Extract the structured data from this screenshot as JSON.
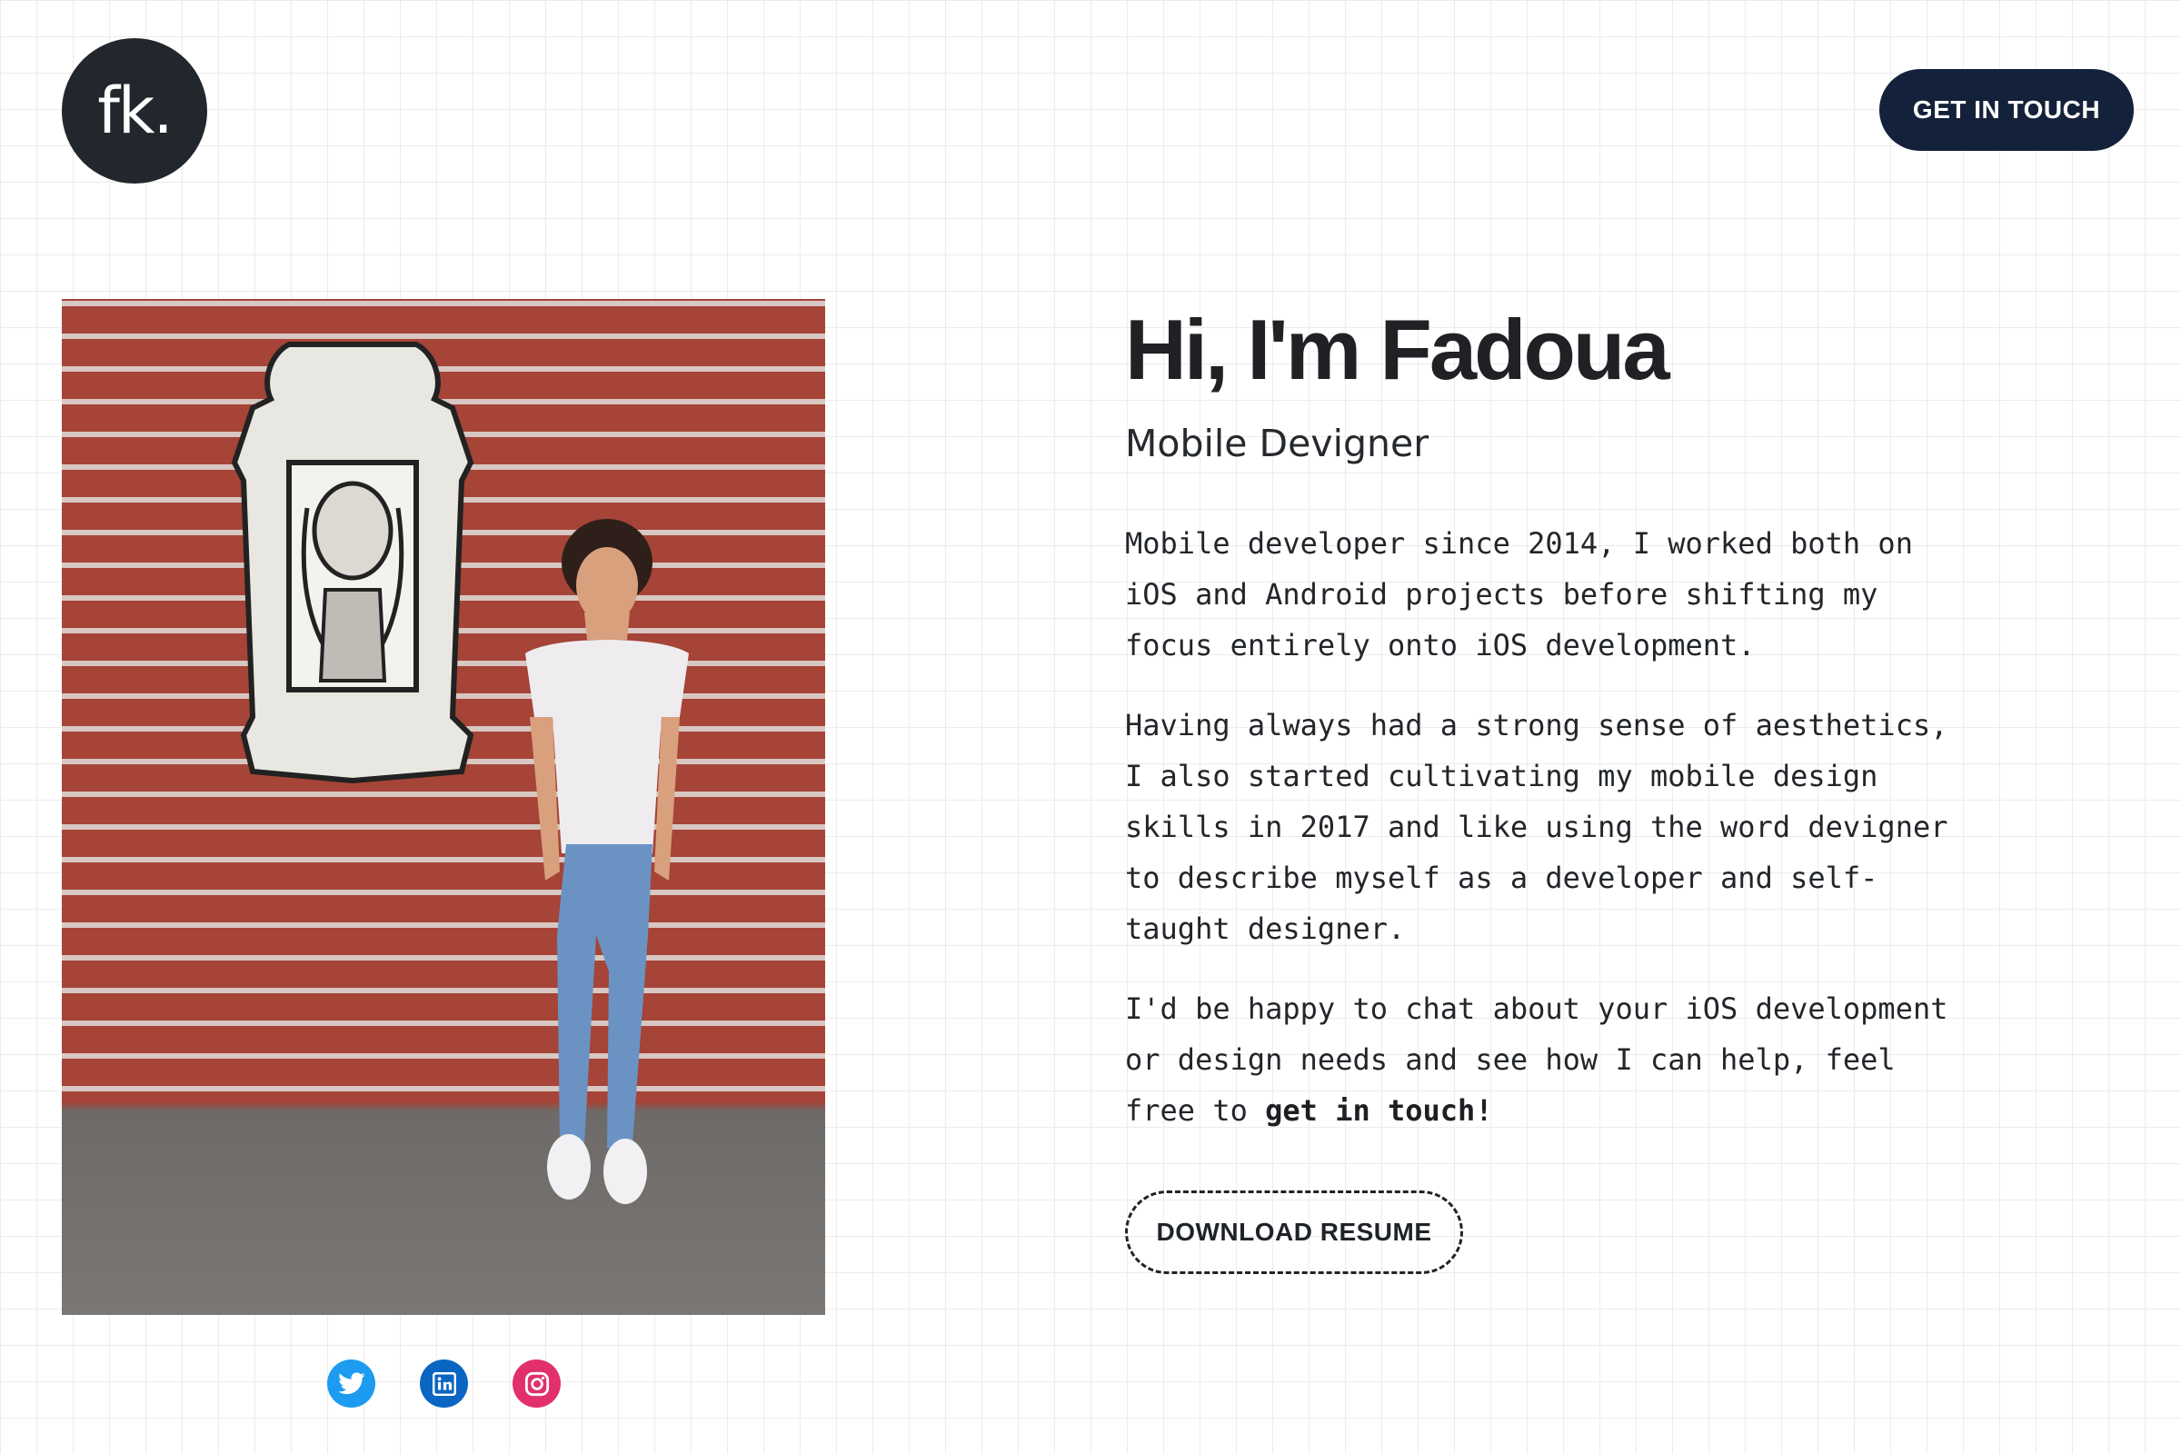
{
  "header": {
    "logo_text": "fk.",
    "cta_label": "GET IN TOUCH",
    "colors": {
      "logo_bg": "#22272d",
      "cta_bg": "#14213a"
    }
  },
  "hero": {
    "title": "Hi, I'm Fadoua",
    "subtitle": "Mobile Devigner",
    "paragraph_1": "Mobile developer since 2014, I worked both on iOS and Android projects before shifting my focus entirely onto iOS development.",
    "paragraph_2": "Having always had a strong sense of aesthetics, I also started cultivating my mobile design skills in 2017 and like using the word devigner to describe myself as a developer and self-taught designer.",
    "paragraph_3_text": "I'd be happy to chat about your iOS development or design needs and see how I can help, feel free to",
    "paragraph_3_link": "get in touch!",
    "download_label": "DOWNLOAD RESUME"
  },
  "socials": [
    {
      "name": "twitter-icon",
      "color": "#1d9bf0"
    },
    {
      "name": "linkedin-icon",
      "color": "#0a66c2"
    },
    {
      "name": "instagram-icon",
      "color": "#e1306c"
    }
  ]
}
